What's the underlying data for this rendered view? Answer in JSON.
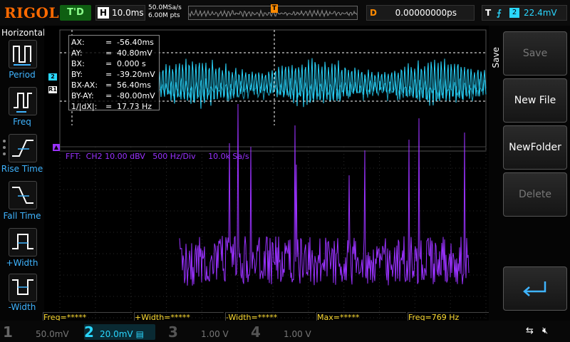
{
  "header": {
    "logo": "RIGOL",
    "run_status": "T'D",
    "horizontal": {
      "label": "H",
      "value": "10.0ms"
    },
    "sample_rate": "50.0MSa/s",
    "memory_depth": "6.00M pts",
    "trigger_position_marker": "T",
    "delay": {
      "label": "D",
      "value": "0.00000000ps"
    },
    "trigger": {
      "label": "T",
      "edge": "rising",
      "source": "2",
      "level": "22.4mV"
    }
  },
  "left_panel": {
    "title": "Horizontal",
    "items": [
      {
        "label": "Period",
        "icon": "period-icon"
      },
      {
        "label": "Freq",
        "icon": "freq-icon"
      },
      {
        "label": "Rise Time",
        "icon": "rise-time-icon"
      },
      {
        "label": "Fall Time",
        "icon": "fall-time-icon"
      },
      {
        "label": "+Width",
        "icon": "positive-width-icon"
      },
      {
        "label": "-Width",
        "icon": "negative-width-icon"
      }
    ]
  },
  "cursor_readout": [
    {
      "key": "AX:",
      "value": "-56.40ms"
    },
    {
      "key": "AY:",
      "value": "40.80mV"
    },
    {
      "key": "BX:",
      "value": "0.000 s"
    },
    {
      "key": "BY:",
      "value": "-39.20mV"
    },
    {
      "key": "BX-AX:",
      "value": "56.40ms"
    },
    {
      "key": "BY-AY:",
      "value": "-80.00mV"
    },
    {
      "key": "1/|dX|:",
      "value": "17.73 Hz"
    }
  ],
  "markers": {
    "ch2": "2",
    "r1": "R1"
  },
  "fft": {
    "label": "FFT:  CH2 10.00 dBV   500 Hz/Div     10.0k Sa/s",
    "color": "#9a32ff"
  },
  "waveform": {
    "color": "#2ad7ff"
  },
  "right_panel": {
    "title": "Save",
    "buttons": [
      {
        "label": "Save",
        "enabled": false
      },
      {
        "label": "New File",
        "enabled": true
      },
      {
        "label": "NewFolder",
        "enabled": true
      },
      {
        "label": "Delete",
        "enabled": false
      },
      {
        "label": "",
        "icon": "enter-icon",
        "enabled": true
      }
    ]
  },
  "measurements": [
    {
      "text": "Freq=*****"
    },
    {
      "text": "+Width=*****"
    },
    {
      "text": "-Width=*****"
    },
    {
      "text": "Max=*****"
    },
    {
      "text": "Freq=769 Hz"
    }
  ],
  "channels": [
    {
      "num": "1",
      "scale": "50.0mV",
      "active": false
    },
    {
      "num": "2",
      "scale": "20.0mV",
      "active": true
    },
    {
      "num": "3",
      "scale": "1.00 V",
      "active": false
    },
    {
      "num": "4",
      "scale": "1.00 V",
      "active": false
    }
  ],
  "status_icons": [
    "usb-icon",
    "speaker-muted-icon"
  ]
}
